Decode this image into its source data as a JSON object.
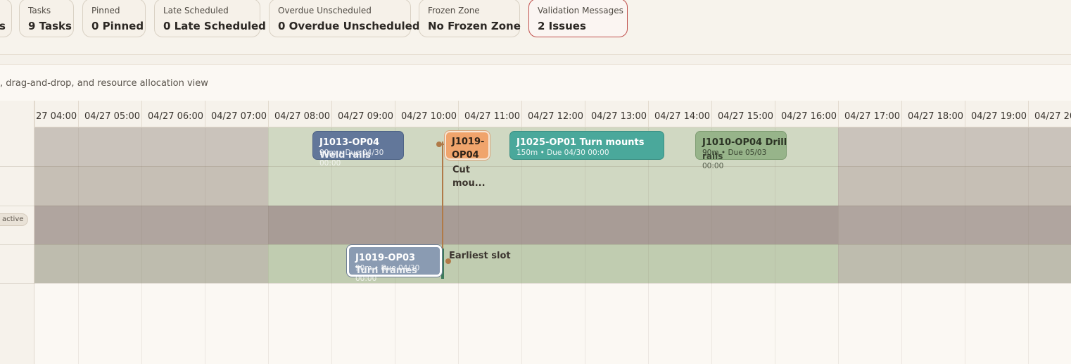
{
  "kpis": {
    "partial": {
      "value": "s"
    },
    "tasks": {
      "label": "Tasks",
      "value": "9 Tasks"
    },
    "pinned": {
      "label": "Pinned",
      "value": "0 Pinned"
    },
    "late": {
      "label": "Late Scheduled",
      "value": "0 Late Scheduled"
    },
    "overdue": {
      "label": "Overdue Unscheduled",
      "value": "0 Overdue Unscheduled"
    },
    "frozen": {
      "label": "Frozen Zone",
      "value": "No Frozen Zone"
    },
    "validation": {
      "label": "Validation Messages",
      "value": "2 Issues"
    }
  },
  "subtitle": ", drag-and-drop, and resource allocation view",
  "timeline": {
    "ticks": [
      "27 04:00",
      "04/27 05:00",
      "04/27 06:00",
      "04/27 07:00",
      "04/27 08:00",
      "04/27 09:00",
      "04/27 10:00",
      "04/27 11:00",
      "04/27 12:00",
      "04/27 13:00",
      "04/27 14:00",
      "04/27 15:00",
      "04/27 16:00",
      "04/27 17:00",
      "04/27 18:00",
      "04/27 19:00",
      "04/27 20"
    ]
  },
  "resources": {
    "inactive_badge": "active"
  },
  "tasks": {
    "j1013": {
      "title": "J1013-OP04",
      "meta": "90m • Due 04/30",
      "desc": "Weld rails",
      "sub": "00:00"
    },
    "j1019_op04": {
      "title": "J1019-",
      "title2": "OP04",
      "desc": "Cut",
      "desc2": "mou..."
    },
    "j1025": {
      "title": "J1025-OP01  Turn mounts",
      "meta": "150m • Due 04/30 00:00"
    },
    "j1010": {
      "title": "J1010-OP04  Drill",
      "meta": "90m • Due 05/03",
      "desc": "rails",
      "sub": "00:00"
    },
    "j1019_op03": {
      "title": "J1019-OP03",
      "meta": "90m • Due 04/30",
      "desc": "Turn frames",
      "sub": "00:00"
    }
  },
  "dependency": {
    "label": "Earliest slot"
  },
  "colors": {
    "accent_alert": "#c0504d",
    "active_window": "#cfd8c2",
    "inactive_row": "#a89c96",
    "task_blue": "#62779a",
    "task_teal": "#4aa89b",
    "task_olive": "#97b48a",
    "task_orange": "#f0a46c",
    "dependency": "#b07a48"
  }
}
